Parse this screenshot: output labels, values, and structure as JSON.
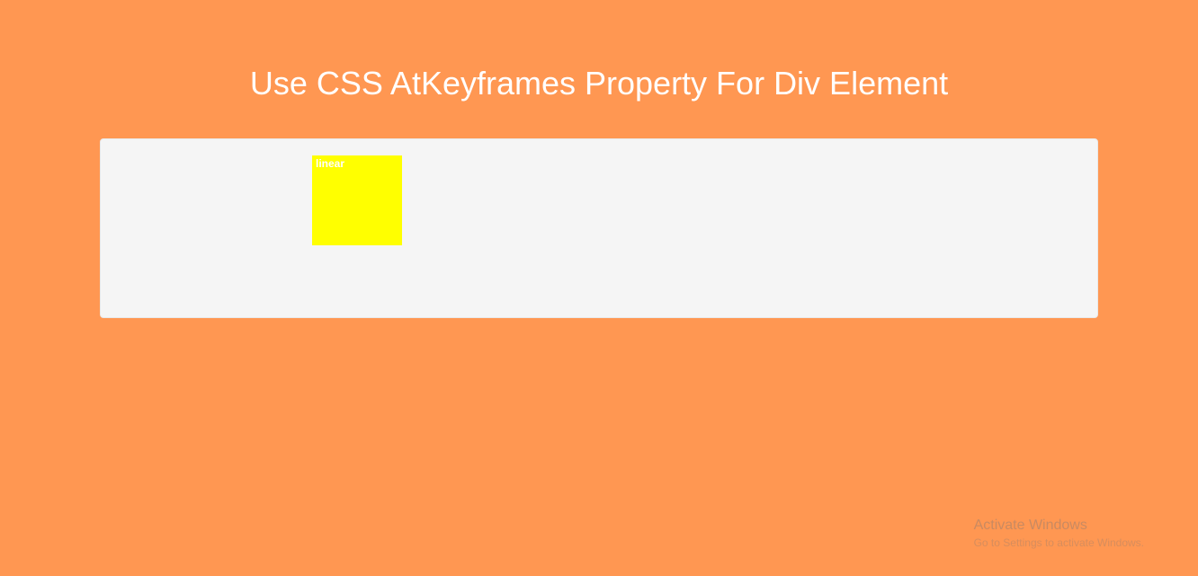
{
  "page": {
    "title": "Use CSS AtKeyframes Property For Div Element"
  },
  "demo": {
    "box_label": "linear",
    "box_color": "#ffff00",
    "container_bg": "#f5f5f5"
  },
  "watermark": {
    "title": "Activate Windows",
    "subtitle": "Go to Settings to activate Windows."
  }
}
